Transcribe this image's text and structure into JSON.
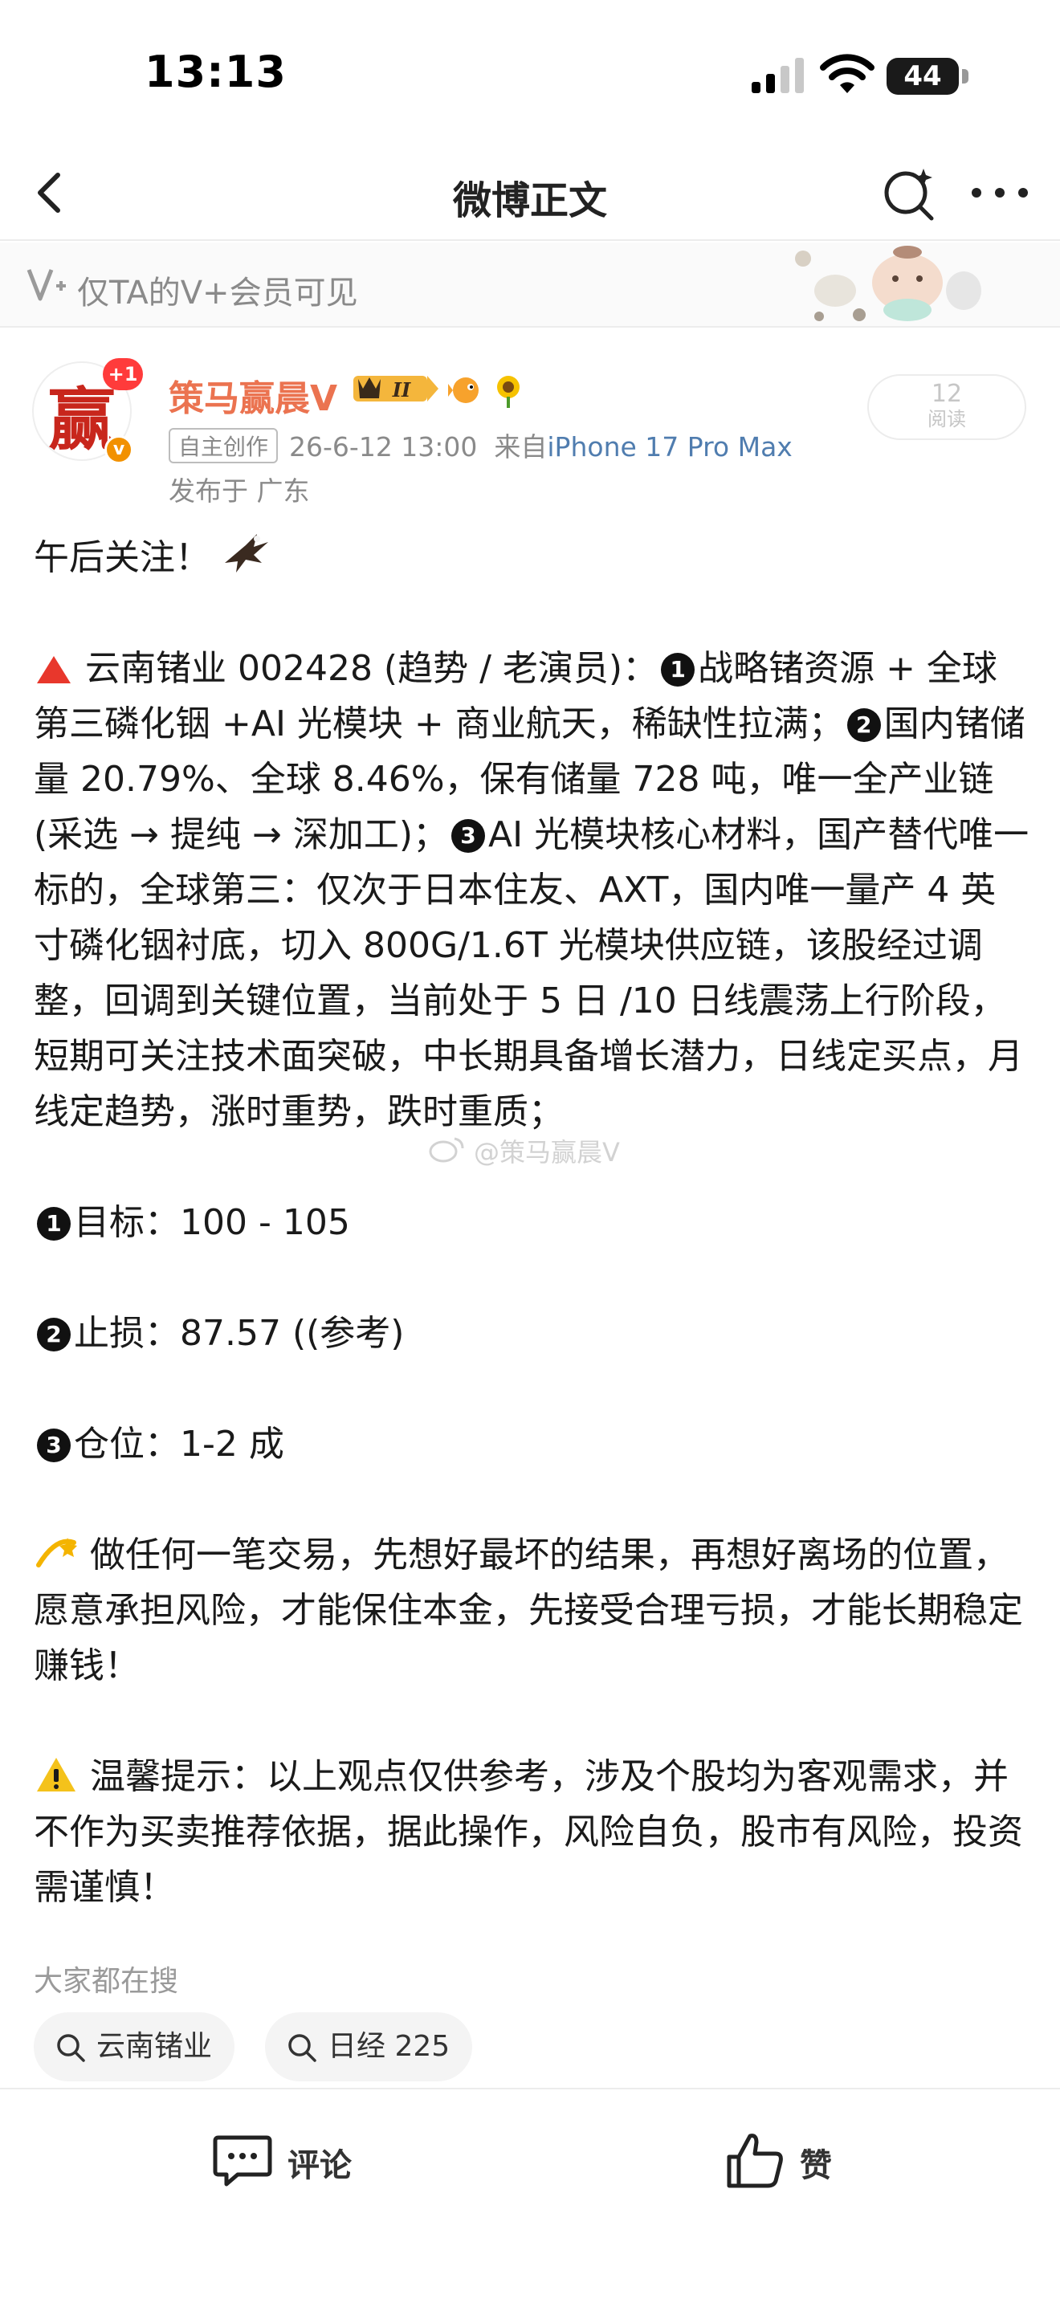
{
  "status_bar": {
    "time": "13:13",
    "battery": "44"
  },
  "nav": {
    "title": "微博正文",
    "back_icon": "chevron-left-icon",
    "search_icon": "sparkle-search-icon",
    "more_icon": "ellipsis-icon"
  },
  "vip_banner": {
    "text": "仅TA的V+会员可见"
  },
  "author": {
    "avatar_char": "赢",
    "new_badge": "+1",
    "name": "策马赢晨V",
    "crown_level": "II",
    "self_made_tag": "自主创作",
    "post_time": "26-6-12 13:00",
    "source_prefix": "来自",
    "device": "iPhone 17 Pro Max",
    "location": "发布于 广东",
    "read_count": "12",
    "read_label": "阅读"
  },
  "post": {
    "line1": "午后关注！",
    "stock_title": "云南锗业 002428 (趋势 / 老演员)：",
    "point1": "战略锗资源 + 全球第三磷化铟 +AI 光模块 + 商业航天，稀缺性拉满；",
    "point2": "国内锗储量 20.79%、全球 8.46%，保有储量 728 吨，唯一全产业链 (采选 → 提纯 → 深加工)；",
    "point3": "AI 光模块核心材料，国产替代唯一标的，全球第三：仅次于日本住友、AXT，国内唯一量产 4 英寸磷化铟衬底，切入 800G/1.6T 光模块供应链，该股经过调整，回调到关键位置，当前处于 5 日 /10 日线震荡上行阶段，短期可关注技术面突破，中长期具备增长潜力，日线定买点，月线定趋势，涨时重势，跌时重质；",
    "n1": "1",
    "n2": "2",
    "n3": "3",
    "target": "目标：100 - 105",
    "stop": "止损：87.57 ((参考)",
    "position": "仓位：1-2 成",
    "advice": "做任何一笔交易，先想好最坏的结果，再想好离场的位置，愿意承担风险，才能保住本金，先接受合理亏损，才能长期稳定赚钱！",
    "warning": "温馨提示：以上观点仅供参考，涉及个股均为客观需求，并不作为买卖推荐依据，据此操作，风险自负，股市有风险，投资需谨慎！",
    "watermark": "@策马赢晨V"
  },
  "search": {
    "title": "大家都在搜",
    "chips": [
      "云南锗业",
      "日经 225"
    ]
  },
  "bottom_bar": {
    "comment": "评论",
    "like": "赞"
  }
}
